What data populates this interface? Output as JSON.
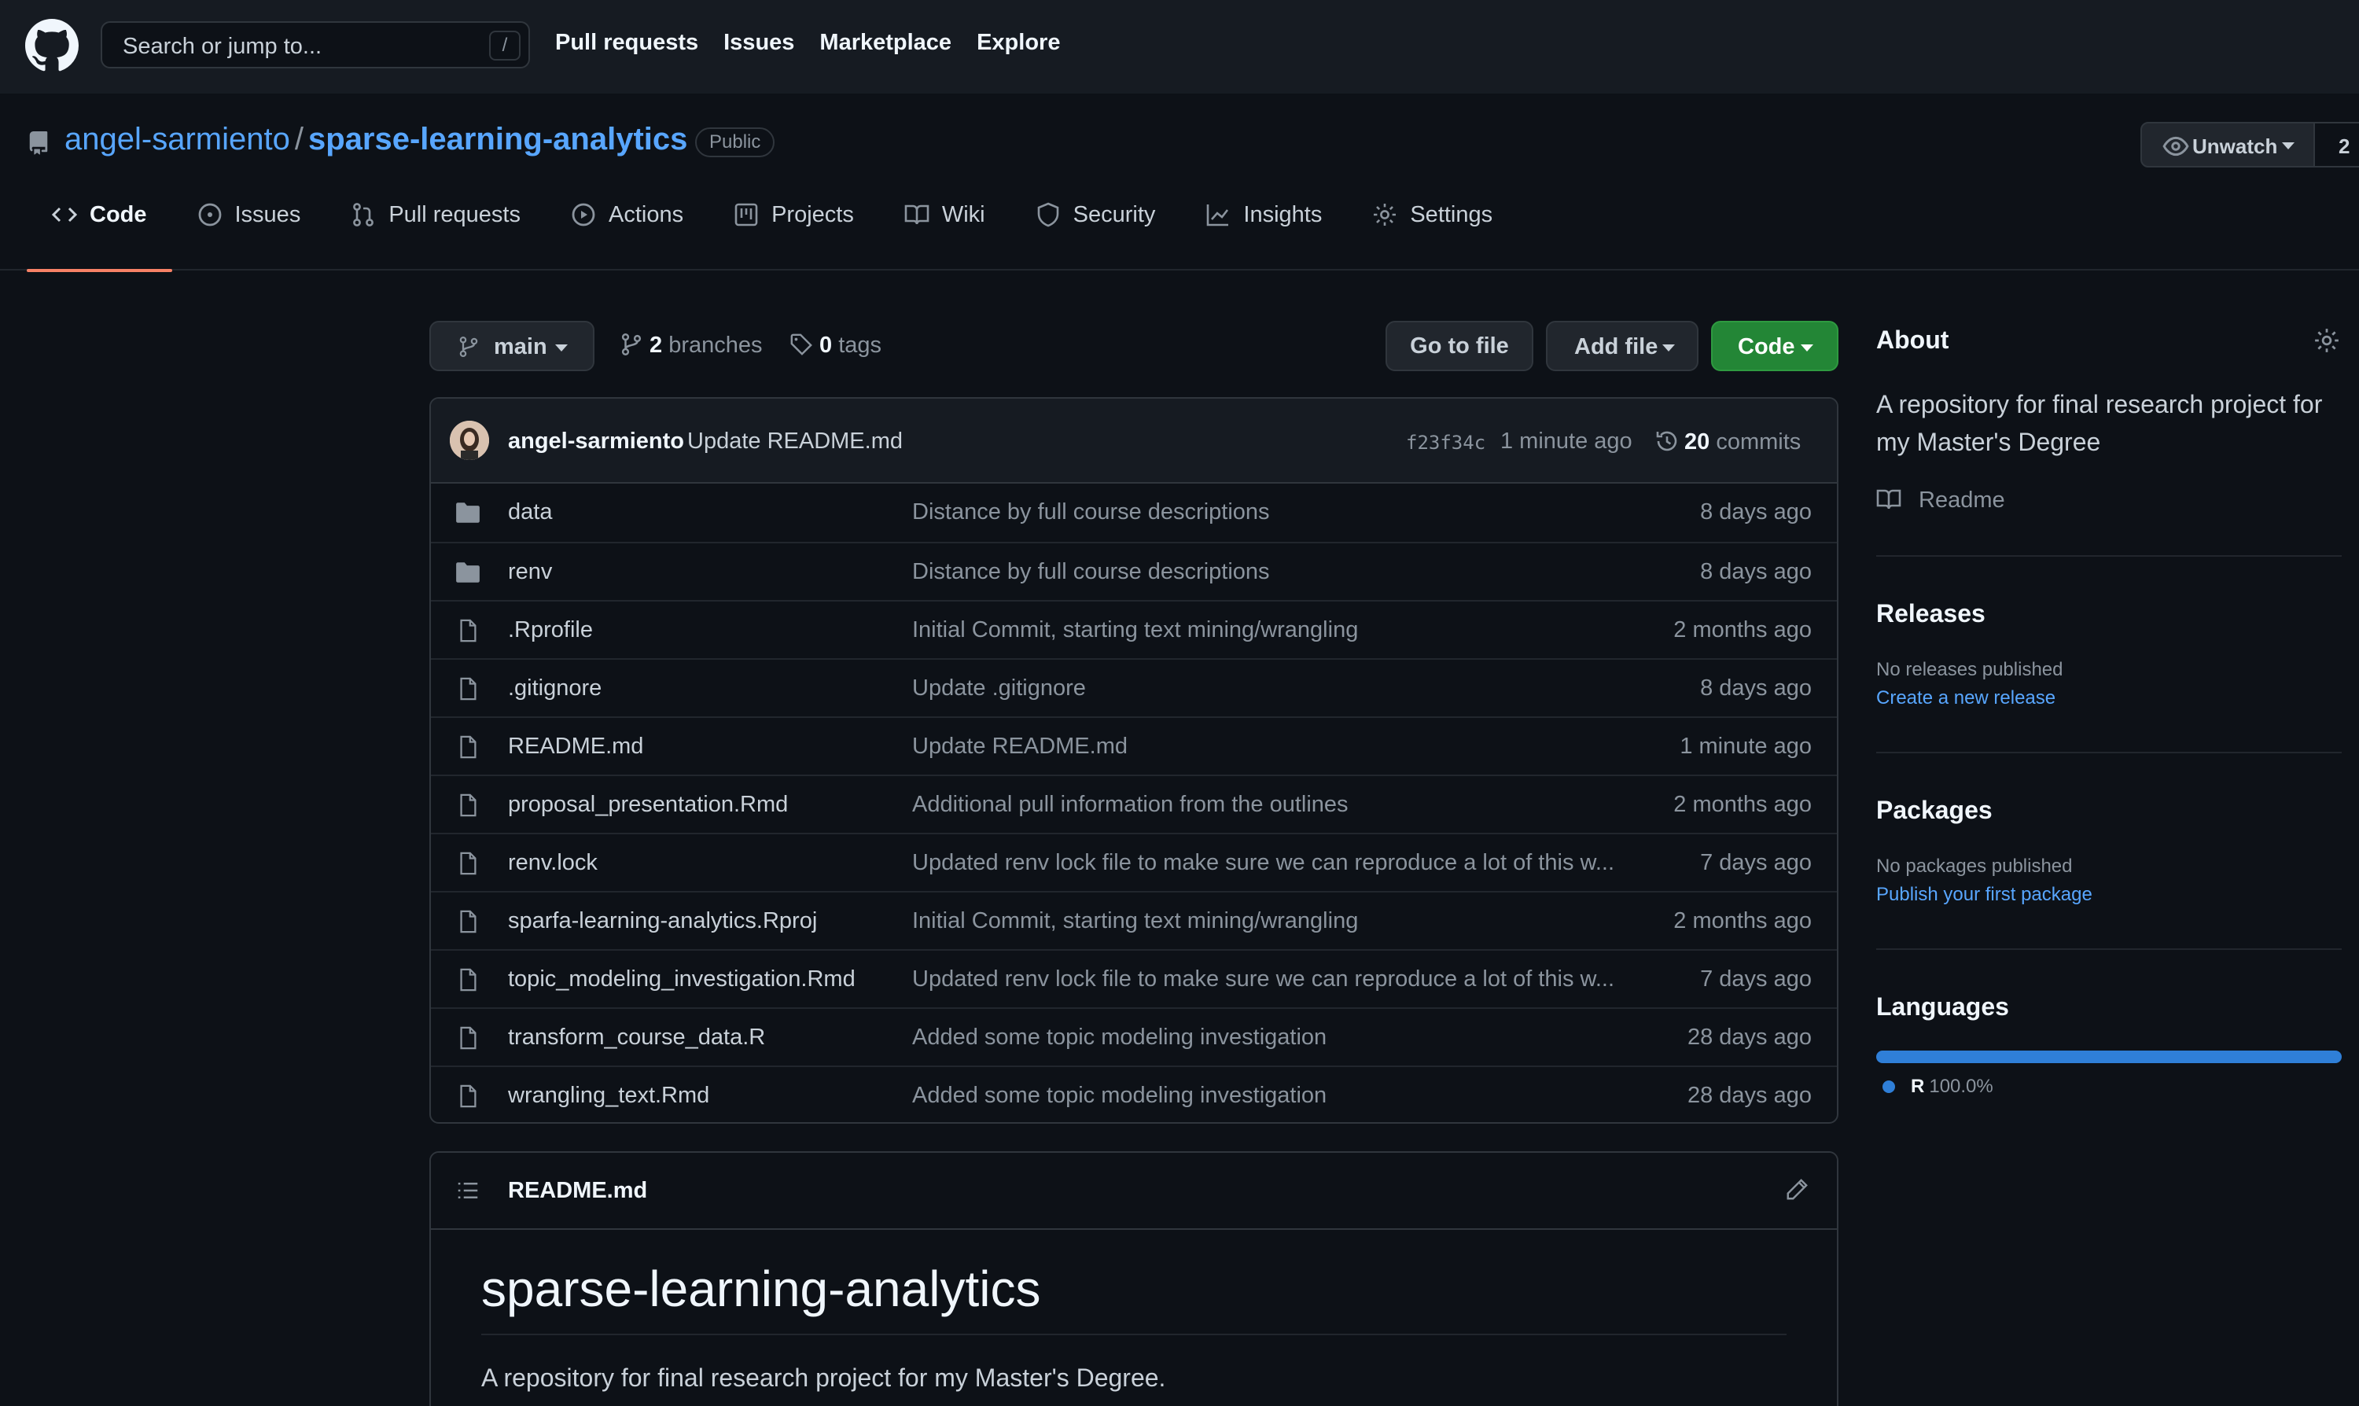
{
  "header": {
    "search_placeholder": "Search or jump to...",
    "search_shortcut": "/",
    "nav": [
      "Pull requests",
      "Issues",
      "Marketplace",
      "Explore"
    ]
  },
  "repo": {
    "owner": "angel-sarmiento",
    "separator": "/",
    "name": "sparse-learning-analytics",
    "visibility": "Public",
    "watch_label": "Unwatch",
    "watch_count": "2",
    "tabs": [
      {
        "label": "Code",
        "icon": "code-icon"
      },
      {
        "label": "Issues",
        "icon": "issue-icon"
      },
      {
        "label": "Pull requests",
        "icon": "pull-request-icon"
      },
      {
        "label": "Actions",
        "icon": "play-icon"
      },
      {
        "label": "Projects",
        "icon": "project-icon"
      },
      {
        "label": "Wiki",
        "icon": "book-icon"
      },
      {
        "label": "Security",
        "icon": "shield-icon"
      },
      {
        "label": "Insights",
        "icon": "graph-icon"
      },
      {
        "label": "Settings",
        "icon": "gear-icon"
      }
    ]
  },
  "branchbar": {
    "branch": "main",
    "branches_count": "2",
    "branches_label": "branches",
    "tags_count": "0",
    "tags_label": "tags",
    "goto_label": "Go to file",
    "addfile_label": "Add file",
    "code_label": "Code"
  },
  "commit": {
    "author": "angel-sarmiento",
    "message": "Update README.md",
    "sha": "f23f34c",
    "time": "1 minute ago",
    "count": "20",
    "count_label": "commits"
  },
  "files": [
    {
      "name": "data",
      "type": "dir",
      "message": "Distance by full course descriptions",
      "age": "8 days ago"
    },
    {
      "name": "renv",
      "type": "dir",
      "message": "Distance by full course descriptions",
      "age": "8 days ago"
    },
    {
      "name": ".Rprofile",
      "type": "file",
      "message": "Initial Commit, starting text mining/wrangling",
      "age": "2 months ago"
    },
    {
      "name": ".gitignore",
      "type": "file",
      "message": "Update .gitignore",
      "age": "8 days ago"
    },
    {
      "name": "README.md",
      "type": "file",
      "message": "Update README.md",
      "age": "1 minute ago"
    },
    {
      "name": "proposal_presentation.Rmd",
      "type": "file",
      "message": "Additional pull information from the outlines",
      "age": "2 months ago"
    },
    {
      "name": "renv.lock",
      "type": "file",
      "message": "Updated renv lock file to make sure we can reproduce a lot of this w...",
      "age": "7 days ago"
    },
    {
      "name": "sparfa-learning-analytics.Rproj",
      "type": "file",
      "message": "Initial Commit, starting text mining/wrangling",
      "age": "2 months ago"
    },
    {
      "name": "topic_modeling_investigation.Rmd",
      "type": "file",
      "message": "Updated renv lock file to make sure we can reproduce a lot of this w...",
      "age": "7 days ago"
    },
    {
      "name": "transform_course_data.R",
      "type": "file",
      "message": "Added some topic modeling investigation",
      "age": "28 days ago"
    },
    {
      "name": "wrangling_text.Rmd",
      "type": "file",
      "message": "Added some topic modeling investigation",
      "age": "28 days ago"
    }
  ],
  "readme": {
    "filename": "README.md",
    "heading": "sparse-learning-analytics",
    "paragraph": "A repository for final research project for my Master's Degree."
  },
  "sidebar": {
    "about_title": "About",
    "about_desc": "A repository for final research project for my Master's Degree",
    "readme_link": "Readme",
    "releases_title": "Releases",
    "releases_none": "No releases published",
    "releases_link": "Create a new release",
    "packages_title": "Packages",
    "packages_none": "No packages published",
    "packages_link": "Publish your first package",
    "languages_title": "Languages",
    "languages": [
      {
        "name": "R",
        "percent": "100.0%",
        "fraction": 1.0,
        "color": "#2f7fd8"
      }
    ]
  },
  "colors": {
    "accent_link": "#58a6ff",
    "active_tab_underline": "#f78166",
    "code_button": "#238636",
    "background": "#0d1117"
  }
}
